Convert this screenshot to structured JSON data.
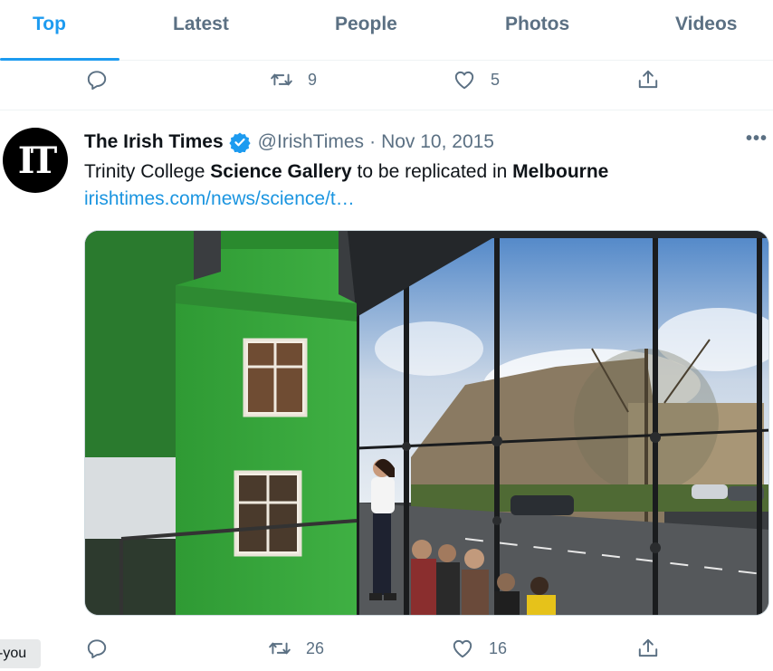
{
  "tabs": [
    {
      "label": "Top",
      "active": true
    },
    {
      "label": "Latest"
    },
    {
      "label": "People"
    },
    {
      "label": "Photos"
    },
    {
      "label": "Videos"
    }
  ],
  "prev_tweet_actions": {
    "reply_count": "",
    "retweet_count": "9",
    "like_count": "5"
  },
  "tweet": {
    "author_name": "The Irish Times",
    "verified": true,
    "handle": "@IrishTimes",
    "separator": "·",
    "date": "Nov 10, 2015",
    "avatar_logo": "IT",
    "text_parts": {
      "p1": "Trinity College ",
      "b1": "Science Gallery",
      "p2": " to be replicated in ",
      "b2": "Melbourne"
    },
    "link": "irishtimes.com/news/science/t…",
    "more_label": "•••",
    "image_icon": "photo-science-gallery",
    "actions": {
      "reply_count": "",
      "retweet_count": "26",
      "like_count": "16"
    }
  },
  "tooltip_text": "-you",
  "colors": {
    "accent": "#1d9bf0",
    "muted": "#5b7083",
    "link": "#1b95e0",
    "verified": "#1d9bf0"
  }
}
